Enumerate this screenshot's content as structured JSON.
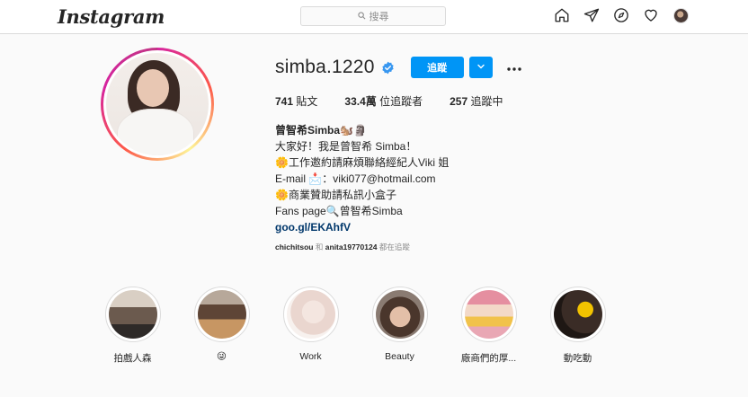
{
  "app": {
    "logo": "Instagram"
  },
  "search": {
    "placeholder": "搜尋"
  },
  "nav": {
    "icons": [
      "home-icon",
      "direct-icon",
      "explore-icon",
      "activity-heart-icon",
      "profile-avatar"
    ]
  },
  "profile": {
    "username": "simba.1220",
    "verified": true,
    "follow_label": "追蹤",
    "stats": {
      "posts_count": "741",
      "posts_label": "貼文",
      "followers_count": "33.4萬",
      "followers_label": "位追蹤者",
      "following_count": "257",
      "following_label": "追蹤中"
    },
    "bio": {
      "name": "曾智希Simba🐿️🗿",
      "lines": [
        "大家好！我是曾智希 Simba！",
        "🌼工作邀約請麻煩聯絡經紀人Viki 姐",
        "E-mail 📩：viki077@hotmail.com",
        "🌼商業贊助請私訊小盒子",
        "Fans page🔍曾智希Simba"
      ],
      "link": "goo.gl/EKAhfV"
    },
    "followed_by": {
      "user1": "chichitsou",
      "conj": "和",
      "user2": "anita19770124",
      "suffix": "都在追蹤"
    }
  },
  "highlights": [
    {
      "label": "拍戲人森"
    },
    {
      "label": "😜"
    },
    {
      "label": "Work"
    },
    {
      "label": "Beauty"
    },
    {
      "label": "廠商們的厚..."
    },
    {
      "label": "動吃動"
    }
  ],
  "colors": {
    "accent": "#0095f6",
    "link": "#00376b",
    "background": "#fafafa",
    "border": "#dbdbdb"
  }
}
